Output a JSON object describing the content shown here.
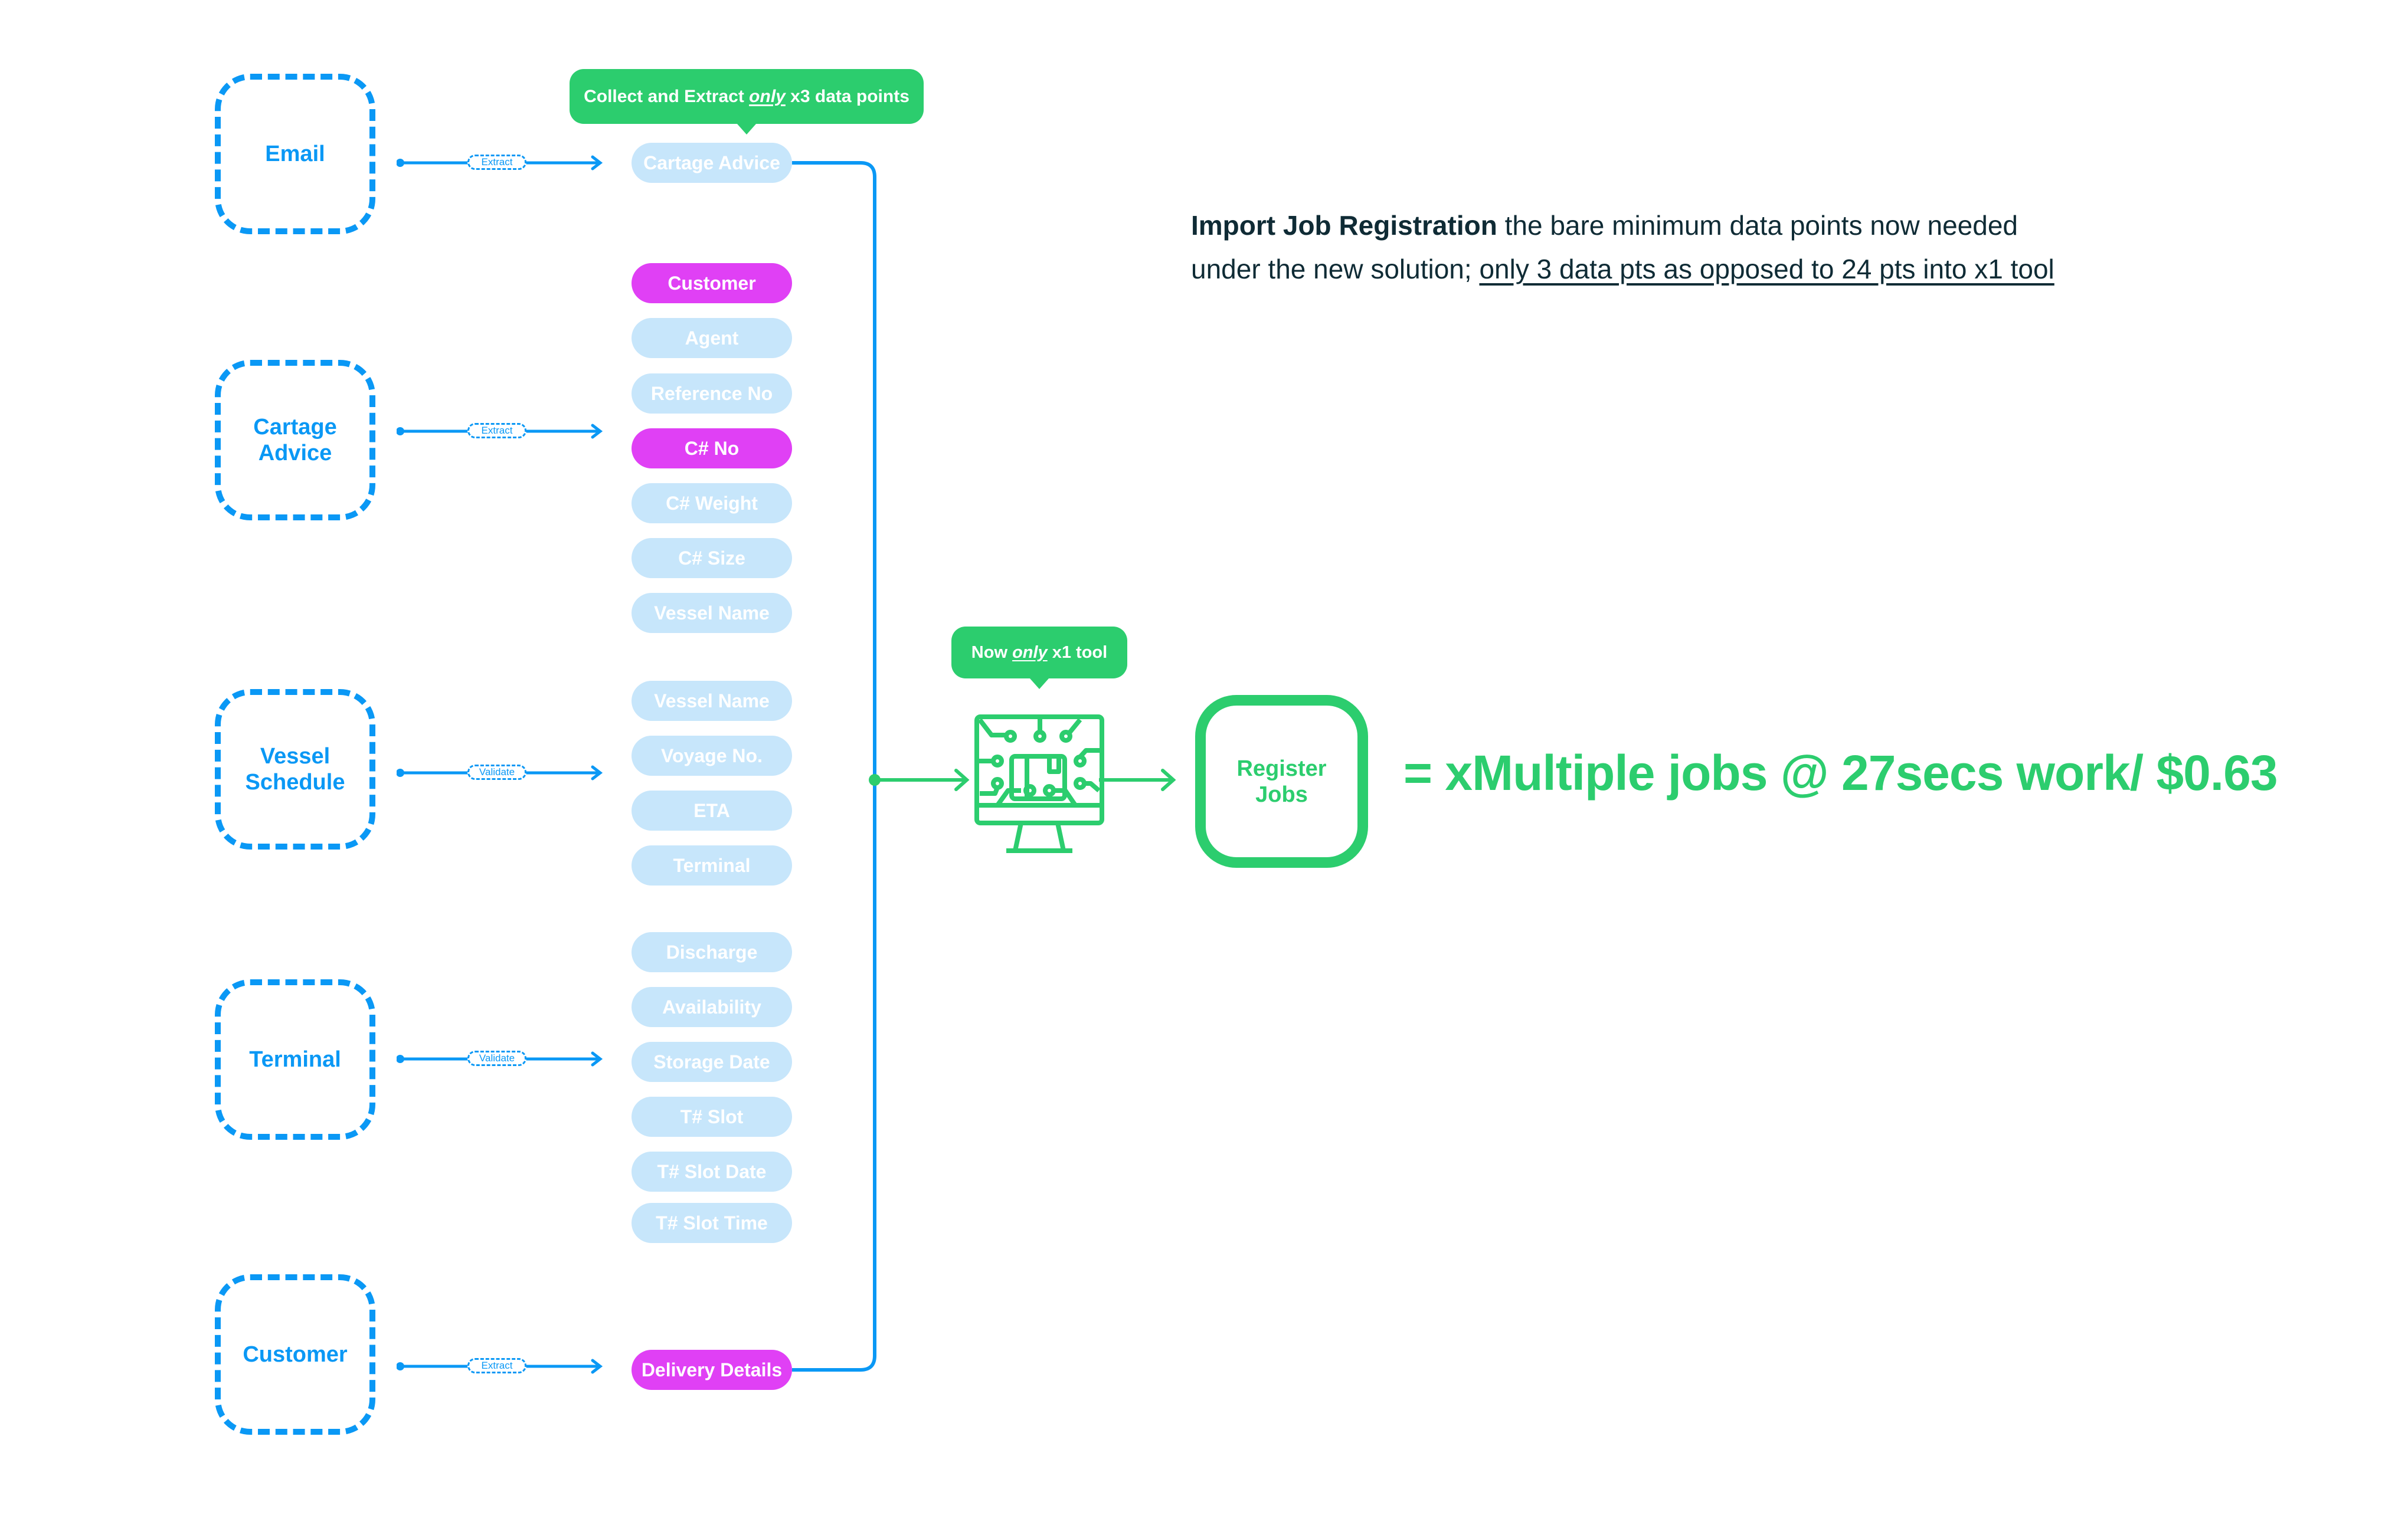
{
  "colors": {
    "source_blue": "#0a98f5",
    "pill_faded": "#c7e6fb",
    "pill_active": "#e040f5",
    "accent_green": "#2ccd6e",
    "text_dark": "#0f2b35"
  },
  "sources": [
    {
      "label": "Email",
      "action": "Extract"
    },
    {
      "label": "Cartage Advice",
      "action": "Extract"
    },
    {
      "label": "Vessel Schedule",
      "action": "Validate"
    },
    {
      "label": "Terminal",
      "action": "Validate"
    },
    {
      "label": "Customer",
      "action": "Extract"
    }
  ],
  "tooltip_collect": {
    "prefix": "Collect and Extract ",
    "emphasis": "only",
    "suffix": " x3 data points"
  },
  "tooltip_tool": {
    "prefix": "Now ",
    "emphasis": "only",
    "suffix": " x1 tool"
  },
  "data_points": [
    {
      "label": "Cartage Advice",
      "state": "faded"
    },
    {
      "label": "Customer",
      "state": "active"
    },
    {
      "label": "Agent",
      "state": "faded"
    },
    {
      "label": "Reference No",
      "state": "faded"
    },
    {
      "label": "C# No",
      "state": "active"
    },
    {
      "label": "C# Weight",
      "state": "faded"
    },
    {
      "label": "C# Size",
      "state": "faded"
    },
    {
      "label": "Vessel Name",
      "state": "faded"
    },
    {
      "label": "Vessel Name",
      "state": "faded"
    },
    {
      "label": "Voyage No.",
      "state": "faded"
    },
    {
      "label": "ETA",
      "state": "faded"
    },
    {
      "label": "Terminal",
      "state": "faded"
    },
    {
      "label": "Discharge",
      "state": "faded"
    },
    {
      "label": "Availability",
      "state": "faded"
    },
    {
      "label": "Storage Date",
      "state": "faded"
    },
    {
      "label": "T# Slot",
      "state": "faded"
    },
    {
      "label": "T# Slot Date",
      "state": "faded"
    },
    {
      "label": "T# Slot Time",
      "state": "faded"
    },
    {
      "label": "Delivery Details",
      "state": "active"
    }
  ],
  "tool_icon": "circuit-monitor-icon",
  "register": {
    "line1": "Register",
    "line2": "Jobs"
  },
  "headline": "= xMultiple jobs @ 27secs work/ $0.63",
  "description": {
    "bold": "Import Job Registration",
    "line1_rest": " the bare minimum data points now needed",
    "line2_plain": "under the new solution; ",
    "line2_underlined": "only 3 data pts as opposed to 24 pts into x1 tool"
  }
}
